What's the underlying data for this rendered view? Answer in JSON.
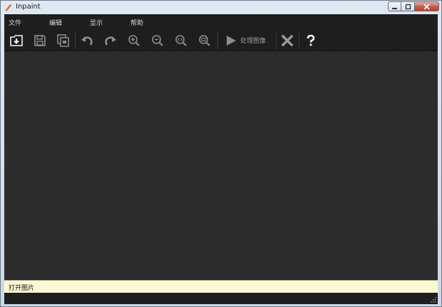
{
  "window": {
    "title": "Inpaint"
  },
  "menu": {
    "items": [
      "文件",
      "编辑",
      "显示",
      "帮助"
    ]
  },
  "toolbar": {
    "process_label": "处理图像"
  },
  "status": {
    "text": "打开图片"
  },
  "colors": {
    "menubar": "#1f1f1f",
    "canvas": "#2c2c2c",
    "status": "#fbf8d4"
  }
}
